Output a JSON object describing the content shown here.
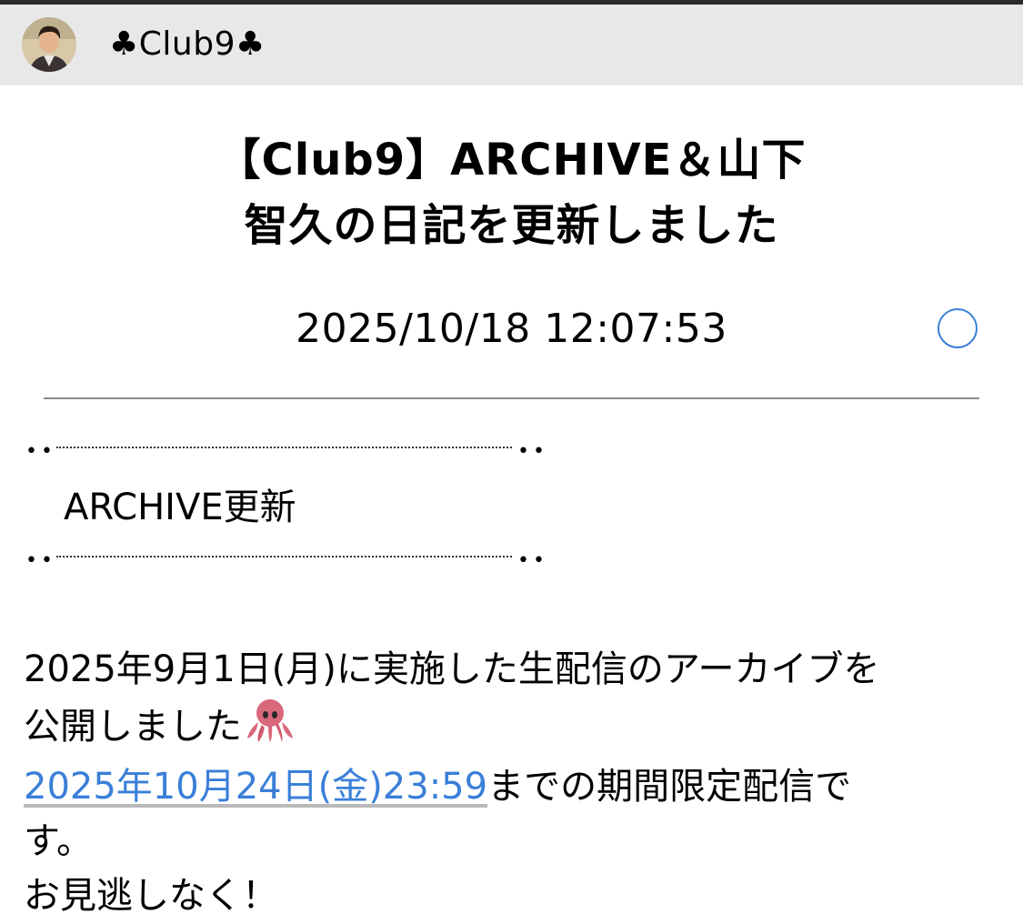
{
  "header": {
    "club_name": "♣Club9♣"
  },
  "post": {
    "title_line1": "【Club9】ARCHIVE＆山下",
    "title_line2": "智久の日記を更新しました",
    "datetime": "2025/10/18 12:07:53",
    "section_label": "ARCHIVE更新",
    "body_line1": "2025年9月1日(月)に実施した生配信のアーカイブを",
    "body_line2": "公開しました",
    "link_text": "2025年10月24日(金)23:59",
    "body_line3_rest": "までの期間限定配信で",
    "body_line4": "す。",
    "body_line5": "お見逃しなく！"
  },
  "colors": {
    "accent": "#3a7fd8",
    "header_bg": "#e8e8e8",
    "divider": "#8a8a8a"
  },
  "icons": {
    "avatar": "profile-photo",
    "read_indicator": "circle-outline-icon",
    "emoji": "octopus-icon"
  }
}
